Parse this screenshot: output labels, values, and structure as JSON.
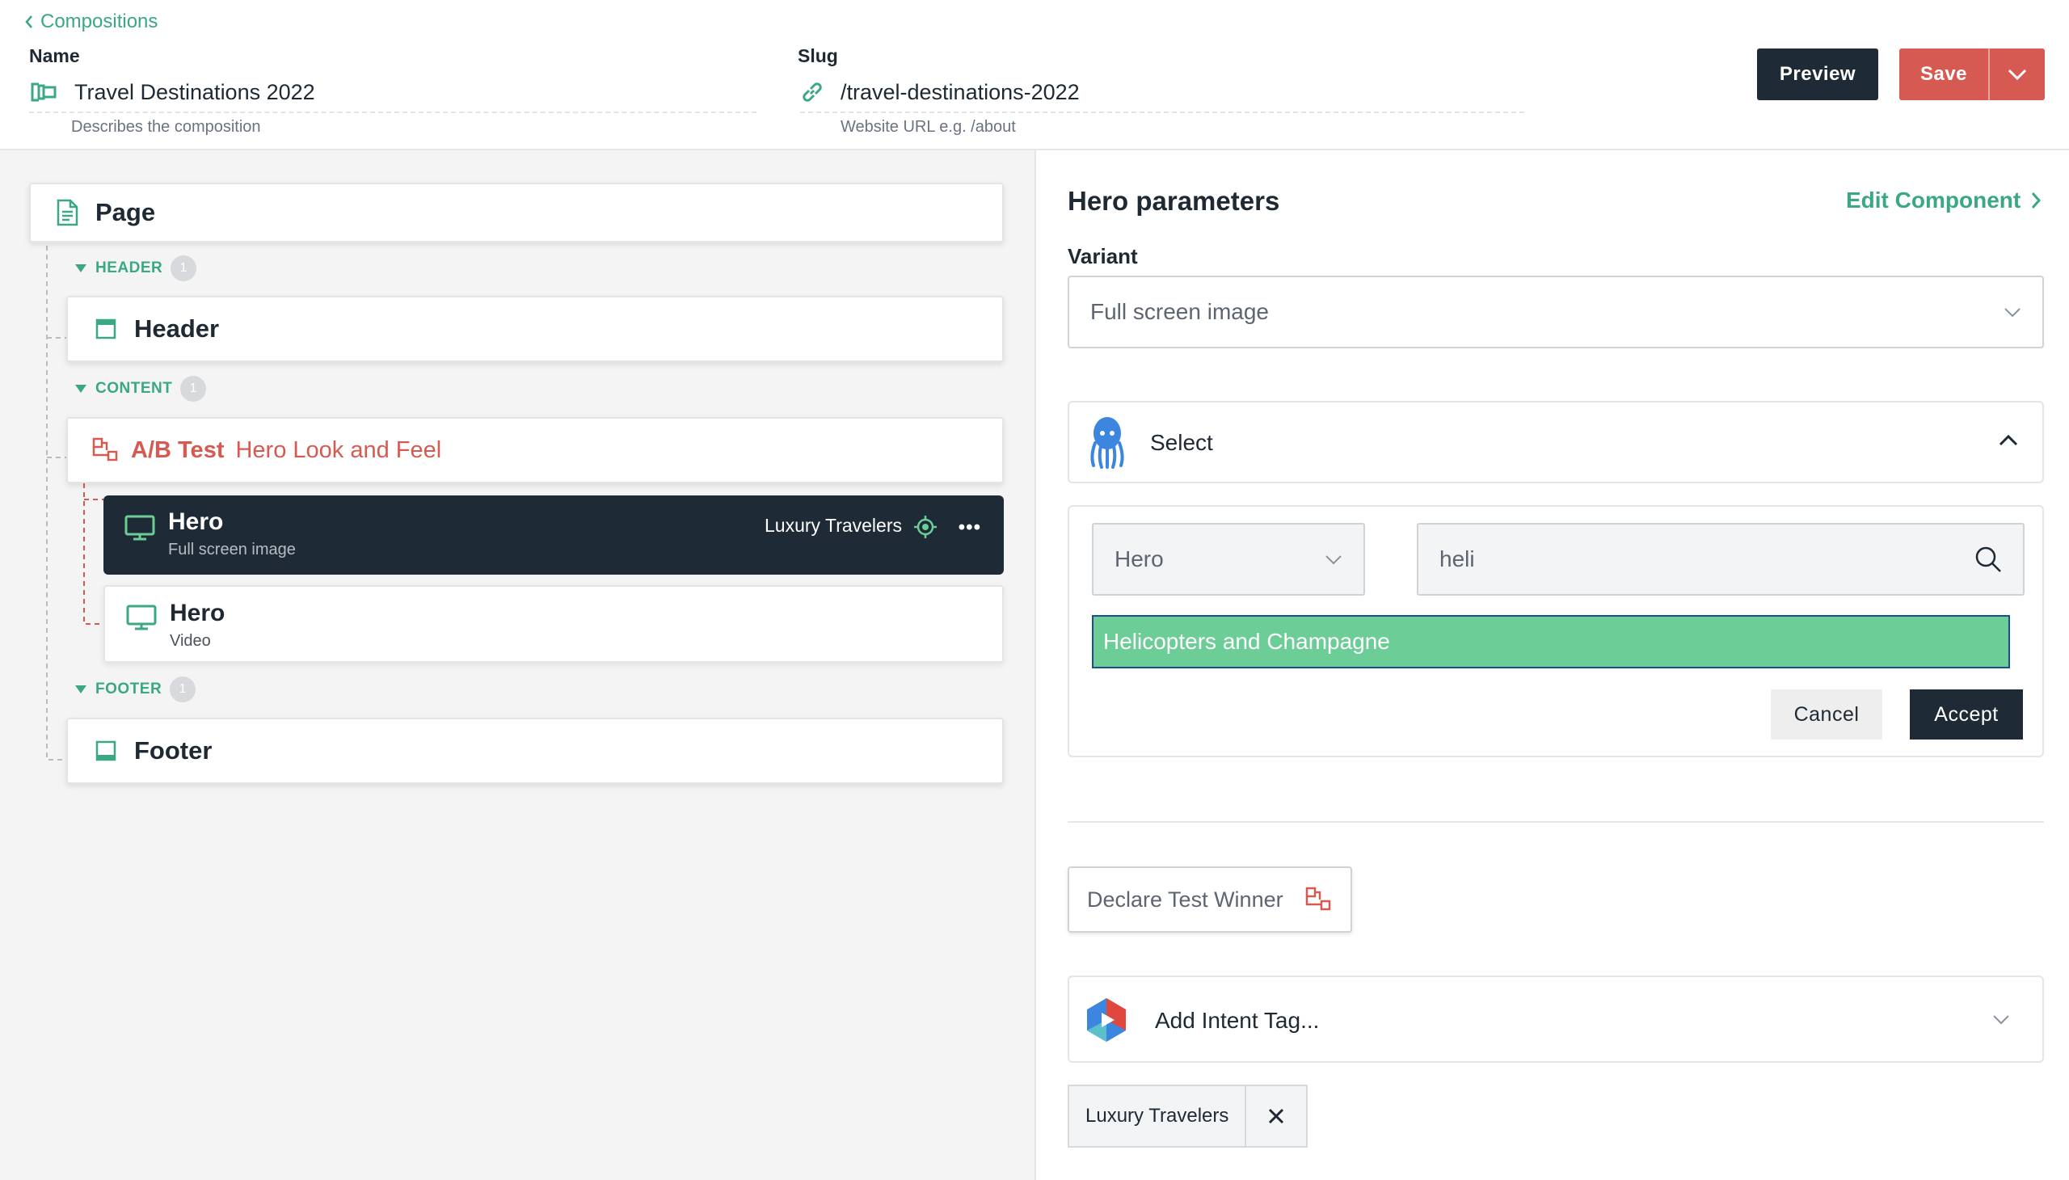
{
  "nav": {
    "back_label": "Compositions"
  },
  "name_field": {
    "label": "Name",
    "value": "Travel Destinations 2022",
    "help": "Describes the composition"
  },
  "slug_field": {
    "label": "Slug",
    "value": "/travel-destinations-2022",
    "help": "Website URL e.g. /about"
  },
  "actions": {
    "preview_label": "Preview",
    "save_label": "Save"
  },
  "tree": {
    "page_label": "Page",
    "header_section": {
      "label": "HEADER",
      "count": "1"
    },
    "header_label": "Header",
    "content_section": {
      "label": "CONTENT",
      "count": "1"
    },
    "ab_test": {
      "prefix": "A/B Test",
      "name": "Hero Look and Feel"
    },
    "hero_selected": {
      "title": "Hero",
      "subtitle": "Full screen image",
      "tag": "Luxury Travelers",
      "more_label": "•••"
    },
    "hero_video": {
      "title": "Hero",
      "subtitle": "Video"
    },
    "footer_section": {
      "label": "FOOTER",
      "count": "1"
    },
    "footer_label": "Footer"
  },
  "params": {
    "title": "Hero parameters",
    "edit_component_label": "Edit Component",
    "variant_label": "Variant",
    "variant_value": "Full screen image",
    "select_label": "Select",
    "type_value": "Hero",
    "search_value": "heli",
    "result_item": "Helicopters and Champagne",
    "cancel_label": "Cancel",
    "accept_label": "Accept",
    "declare_winner_label": "Declare Test Winner",
    "intent_placeholder": "Add Intent Tag...",
    "intent_tag": "Luxury Travelers"
  },
  "colors": {
    "accent_green": "#3aa882",
    "danger_red": "#d65a51",
    "dark": "#1e2a35",
    "highlight_green": "#6dcd97"
  }
}
